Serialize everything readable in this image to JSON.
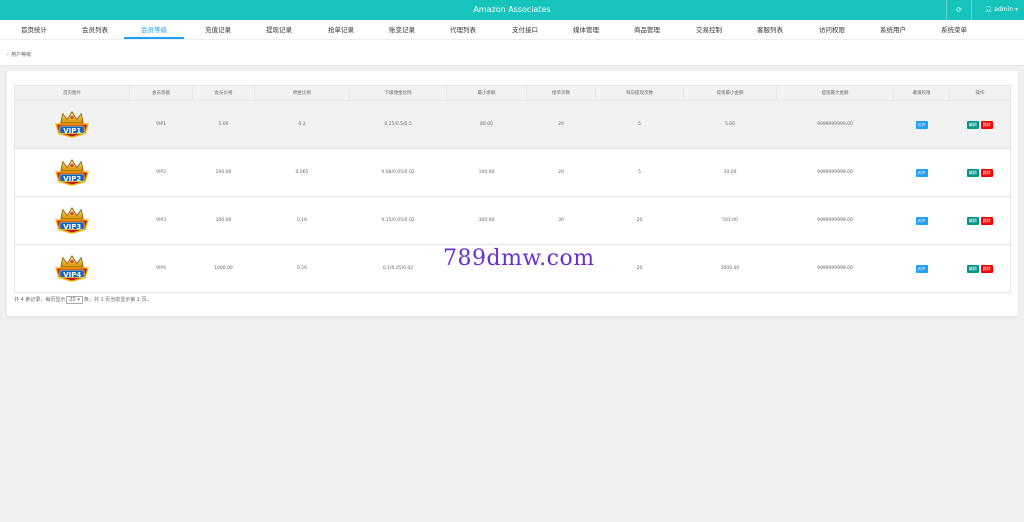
{
  "app": {
    "title": "Amazon Associates",
    "user": "admin"
  },
  "nav": [
    "首页统计",
    "会员列表",
    "会员等级",
    "充值记录",
    "提现记录",
    "抢单记录",
    "账变记录",
    "代理列表",
    "支付接口",
    "媒体管理",
    "商品管理",
    "交易控制",
    "客服列表",
    "访问权限",
    "系统用户",
    "系统菜单"
  ],
  "nav_active": 2,
  "breadcrumb": "用户等级",
  "table": {
    "headers": [
      "首页图片",
      "会员等级",
      "会员价格",
      "佣金比例",
      "下级佣金比例",
      "最小余额",
      "接单次数",
      "每日提现次数",
      "提现最小金额",
      "提现最大金额",
      "邀请权限",
      "操作"
    ],
    "rows": [
      {
        "badge": "VIP1",
        "level": "VIP1",
        "price": "5.00",
        "commission": "0.2",
        "sub_commission": "0.25/0.5/0.5",
        "min_balance": "80.00",
        "orders": "20",
        "daily_withdraw": "5",
        "withdraw_min": "5.00",
        "withdraw_max": "9999999999.00",
        "invite": "允许"
      },
      {
        "badge": "VIP2",
        "level": "VIP2",
        "price": "200.00",
        "commission": "0.065",
        "sub_commission": "0.08/0.05/0.02",
        "min_balance": "100.00",
        "orders": "20",
        "daily_withdraw": "5",
        "withdraw_min": "30.00",
        "withdraw_max": "9999999999.00",
        "invite": "允许"
      },
      {
        "badge": "VIP3",
        "level": "VIP3",
        "price": "300.00",
        "commission": "0.18",
        "sub_commission": "0.15/0.05/0.02",
        "min_balance": "300.00",
        "orders": "30",
        "daily_withdraw": "20",
        "withdraw_min": "501.00",
        "withdraw_max": "9999999999.00",
        "invite": "允许"
      },
      {
        "badge": "VIP4",
        "level": "VIP4",
        "price": "1000.00",
        "commission": "0.26",
        "sub_commission": "0.1/0.05/0.02",
        "min_balance": "",
        "orders": "",
        "daily_withdraw": "20",
        "withdraw_min": "5000.00",
        "withdraw_max": "9999999999.00",
        "invite": "允许"
      }
    ],
    "edit_label": "编辑",
    "delete_label": "删除"
  },
  "pager": {
    "prefix": "共 4 条记录，每页显示",
    "page_size": "20",
    "suffix": "条，共 1 页当前显示第 1 页。"
  },
  "watermark": "789dmw.com",
  "colors": {
    "topbar": "#17c4bb",
    "active": "#1e9fff",
    "price": "#5fb878",
    "edit": "#009688",
    "delete": "#ff0000"
  }
}
